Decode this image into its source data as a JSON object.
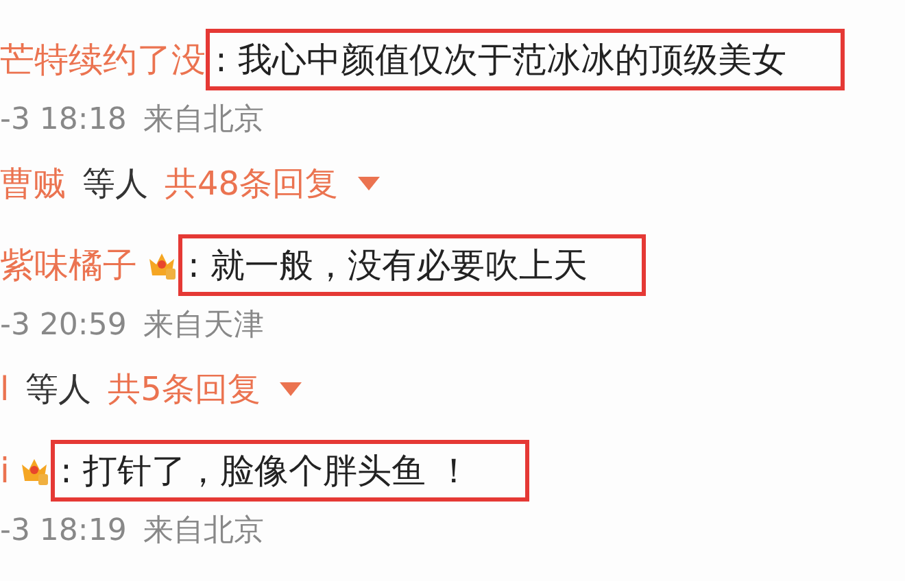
{
  "comments": [
    {
      "user": "芒特续约了没",
      "badge": false,
      "text": ": 我心中颜值仅次于范冰冰的顶级美女",
      "highlighted": true,
      "time": "-3 18:18",
      "location": "来自北京",
      "replies": {
        "users": "曹贼",
        "suffix": "等人",
        "count": "共48条回复"
      }
    },
    {
      "user": "紫味橘子",
      "badge": true,
      "text": ": 就一般，没有必要吹上天",
      "highlighted": true,
      "time": "-3 20:59",
      "location": "来自天津",
      "replies": {
        "users": "l",
        "suffix": "等人",
        "count": "共5条回复"
      }
    },
    {
      "user": "i",
      "badge": true,
      "text": ": 打针了，脸像个胖头鱼 ！",
      "highlighted": true,
      "time": "-3 18:19",
      "location": "来自北京"
    }
  ]
}
